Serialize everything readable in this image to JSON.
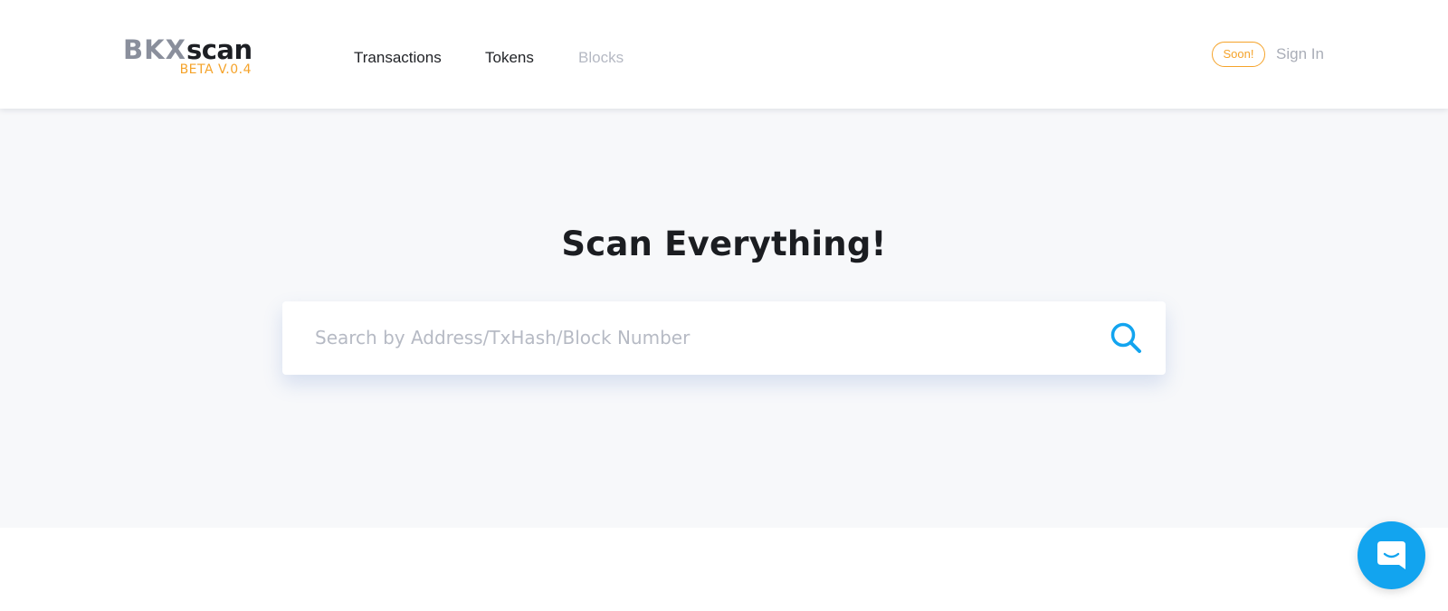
{
  "header": {
    "logo": {
      "part1": "BKX",
      "part2": "scan",
      "version": "BETA V.0.4"
    },
    "nav": [
      {
        "label": "Transactions",
        "state": "active"
      },
      {
        "label": "Tokens",
        "state": "active"
      },
      {
        "label": "Blocks",
        "state": "disabled"
      }
    ],
    "soon_badge": "Soon!",
    "signin_label": "Sign In"
  },
  "hero": {
    "title": "Scan Everything!",
    "search": {
      "placeholder": "Search by Address/TxHash/Block Number",
      "value": ""
    }
  },
  "icons": {
    "search": "search-icon",
    "chat": "chat-icon"
  },
  "colors": {
    "accent_orange": "#f5a32a",
    "accent_blue": "#12a4ef",
    "logo_gray": "#8a8f9c",
    "hero_background": "#f7f8fa",
    "muted_text": "#b5b9c3"
  }
}
